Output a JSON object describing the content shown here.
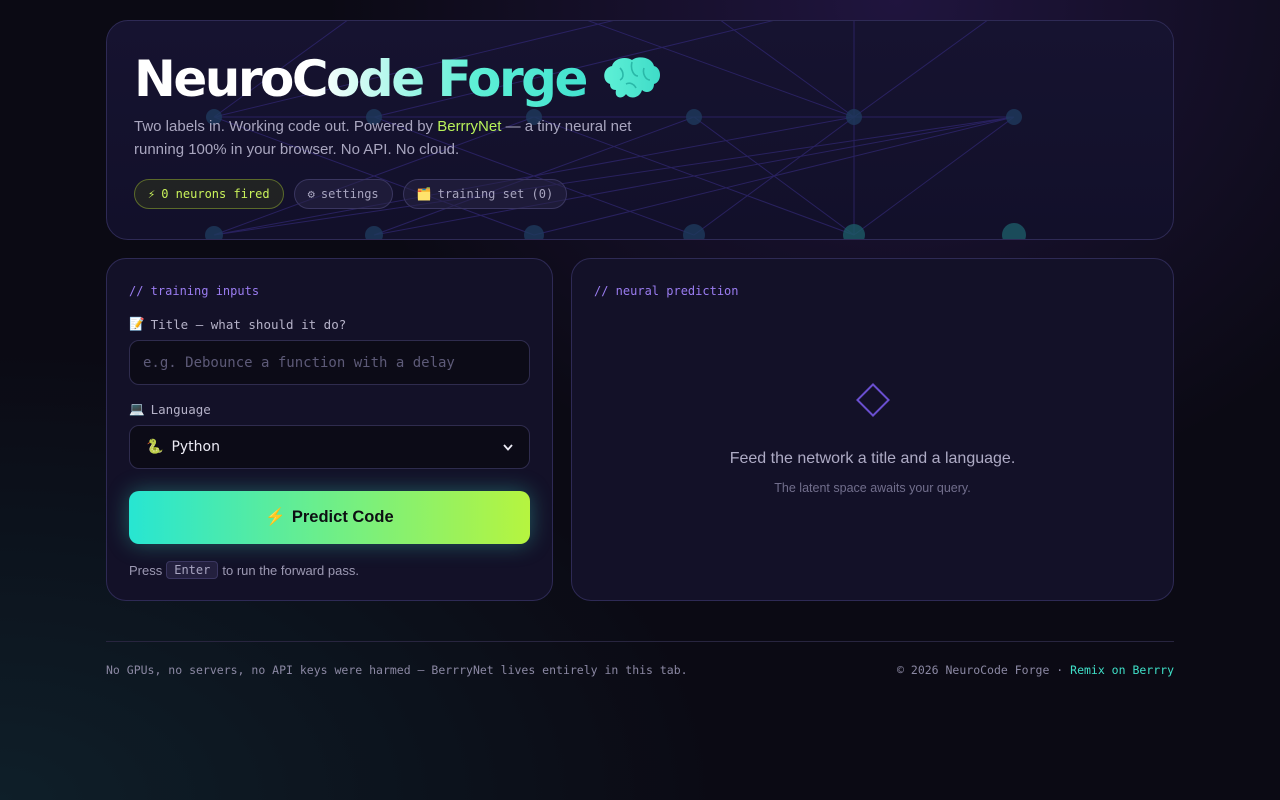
{
  "hero": {
    "title": "NeuroCode Forge",
    "brain_icon": "brain-icon",
    "subtitle_before": "Two labels in. Working code out. Powered by ",
    "subtitle_brand": "BerrryNet",
    "subtitle_after": " — a tiny neural net running 100% in your browser. No API. No cloud.",
    "pills": [
      {
        "icon": "⚡",
        "label": "0 neurons fired"
      },
      {
        "icon": "⚙",
        "label": "settings"
      },
      {
        "icon": "🗂️",
        "label": "training set (0)"
      }
    ]
  },
  "inputs": {
    "section_tag": "// training inputs",
    "title_icon": "📝",
    "title_label": "Title — what should it do?",
    "title_value": "",
    "title_placeholder": "e.g. Debounce a function with a delay",
    "language_icon": "💻",
    "language_label": "Language",
    "language_icon_selected": "🐍",
    "language_selected": "Python",
    "predict_icon": "⚡",
    "predict_label": "Predict Code",
    "hint_before": "Press",
    "hint_key": "Enter",
    "hint_after": "to run the forward pass."
  },
  "prediction": {
    "section_tag": "// neural prediction",
    "empty_message": "Feed the network a title and a language.",
    "empty_sub": "The latent space awaits your query."
  },
  "footer": {
    "left": "No GPUs, no servers, no API keys were harmed — BerrryNet lives entirely in this tab.",
    "right_text": "© 2026 NeuroCode Forge · ",
    "right_link": "Remix on Berrry"
  },
  "colors": {
    "accent_teal": "#3fe0c8",
    "accent_lime": "#b8f25a",
    "accent_purple": "#9a7cf0",
    "background": "#0b0a14"
  }
}
